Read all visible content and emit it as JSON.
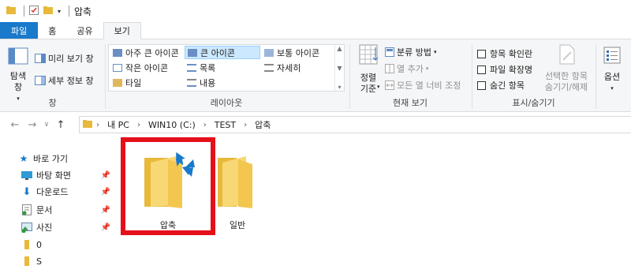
{
  "titlebar": {
    "title": "압축"
  },
  "tabs": [
    "파일",
    "홈",
    "공유",
    "보기"
  ],
  "ribbon": {
    "panes": {
      "label": "창",
      "nav_pane": "탐색\n창",
      "preview_pane": "미리 보기 창",
      "details_pane": "세부 정보 창"
    },
    "layout": {
      "label": "레이아웃",
      "items": [
        "아주 큰 아이콘",
        "큰 아이콘",
        "보통 아이콘",
        "작은 아이콘",
        "목록",
        "자세히",
        "타일",
        "내용"
      ],
      "selected": "큰 아이콘"
    },
    "current_view": {
      "label": "현재 보기",
      "sort": "정렬\n기준",
      "group_by": "분류 방법",
      "add_columns": "열 추가",
      "fit_columns": "모든 열 너비 조정"
    },
    "show_hide": {
      "label": "표시/숨기기",
      "item_checkboxes": "항목 확인란",
      "file_extensions": "파일 확장명",
      "hidden_items": "숨긴 항목",
      "hide_selected": "선택한 항목\n숨기기/해제"
    },
    "options": "옵션"
  },
  "address": {
    "crumbs": [
      "내 PC",
      "WIN10 (C:)",
      "TEST",
      "압축"
    ]
  },
  "sidebar": {
    "quick_access": "바로 가기",
    "items": [
      {
        "label": "바탕 화면",
        "pinned": true
      },
      {
        "label": "다운로드",
        "pinned": true
      },
      {
        "label": "문서",
        "pinned": true
      },
      {
        "label": "사진",
        "pinned": true
      },
      {
        "label": "0",
        "pinned": false
      },
      {
        "label": "S",
        "pinned": false
      }
    ]
  },
  "content": {
    "items": [
      {
        "name": "압축",
        "compressed": true,
        "highlighted": true
      },
      {
        "name": "일반",
        "compressed": false,
        "highlighted": false
      }
    ]
  },
  "colors": {
    "file_tab": "#1979ca",
    "highlight": "#e4101a",
    "folder": "#f8d775",
    "selected_view": "#cce8ff"
  }
}
